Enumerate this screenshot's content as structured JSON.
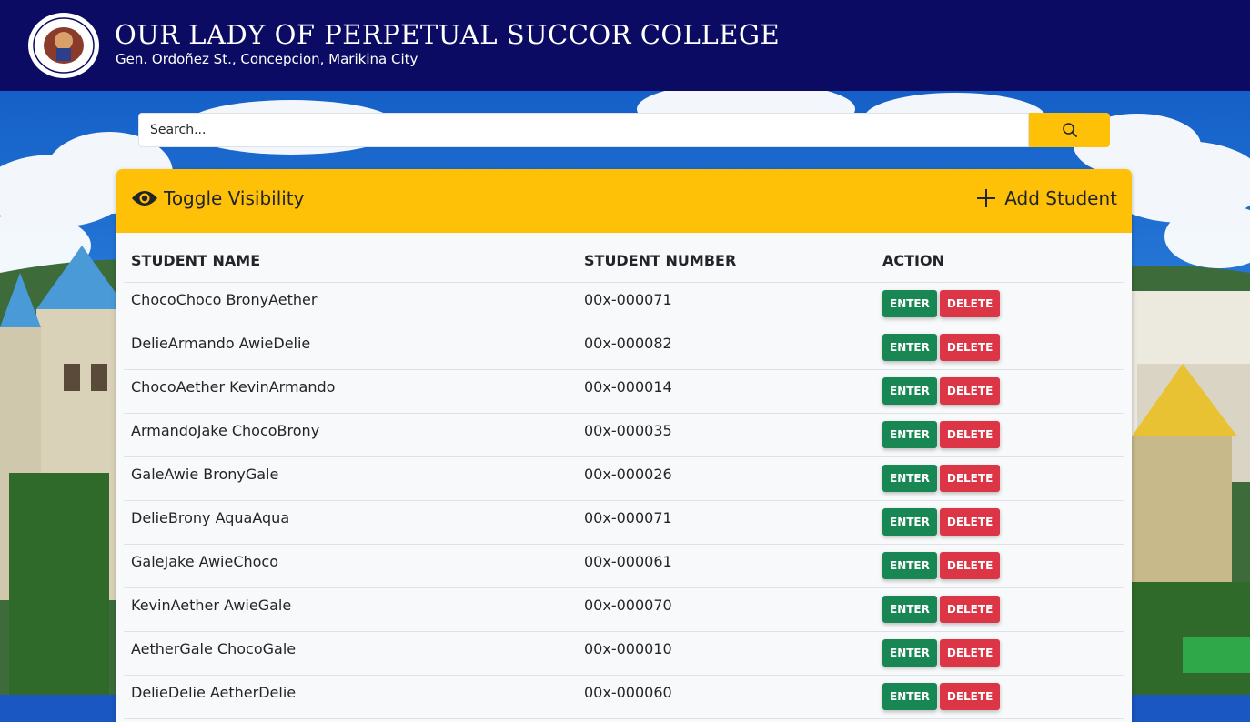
{
  "header": {
    "college_name": "OUR LADY OF PERPETUAL SUCCOR COLLEGE",
    "address": "Gen. Ordoñez St., Concepcion, Marikina City",
    "seal_icon": "college-seal-icon",
    "background_color": "#0b0b63"
  },
  "search": {
    "placeholder": "Search...",
    "button_icon": "search-icon"
  },
  "panel": {
    "toggle_label": "Toggle Visibility",
    "toggle_icon": "eye-icon",
    "add_label": "Add Student",
    "add_icon": "plus-icon",
    "accent_color": "#ffc107"
  },
  "table": {
    "headers": {
      "name": "STUDENT NAME",
      "number": "STUDENT NUMBER",
      "action": "ACTION"
    },
    "enter_label": "ENTER",
    "delete_label": "DELETE",
    "enter_color": "#198754",
    "delete_color": "#dc3545",
    "rows": [
      {
        "name": "ChocoChoco BronyAether",
        "number": "00x-000071"
      },
      {
        "name": "DelieArmando AwieDelie",
        "number": "00x-000082"
      },
      {
        "name": "ChocoAether KevinArmando",
        "number": "00x-000014"
      },
      {
        "name": "ArmandoJake ChocoBrony",
        "number": "00x-000035"
      },
      {
        "name": "GaleAwie BronyGale",
        "number": "00x-000026"
      },
      {
        "name": "DelieBrony AquaAqua",
        "number": "00x-000071"
      },
      {
        "name": "GaleJake AwieChoco",
        "number": "00x-000061"
      },
      {
        "name": "KevinAether AwieGale",
        "number": "00x-000070"
      },
      {
        "name": "AetherGale ChocoGale",
        "number": "00x-000010"
      },
      {
        "name": "DelieDelie AetherDelie",
        "number": "00x-000060"
      }
    ]
  }
}
